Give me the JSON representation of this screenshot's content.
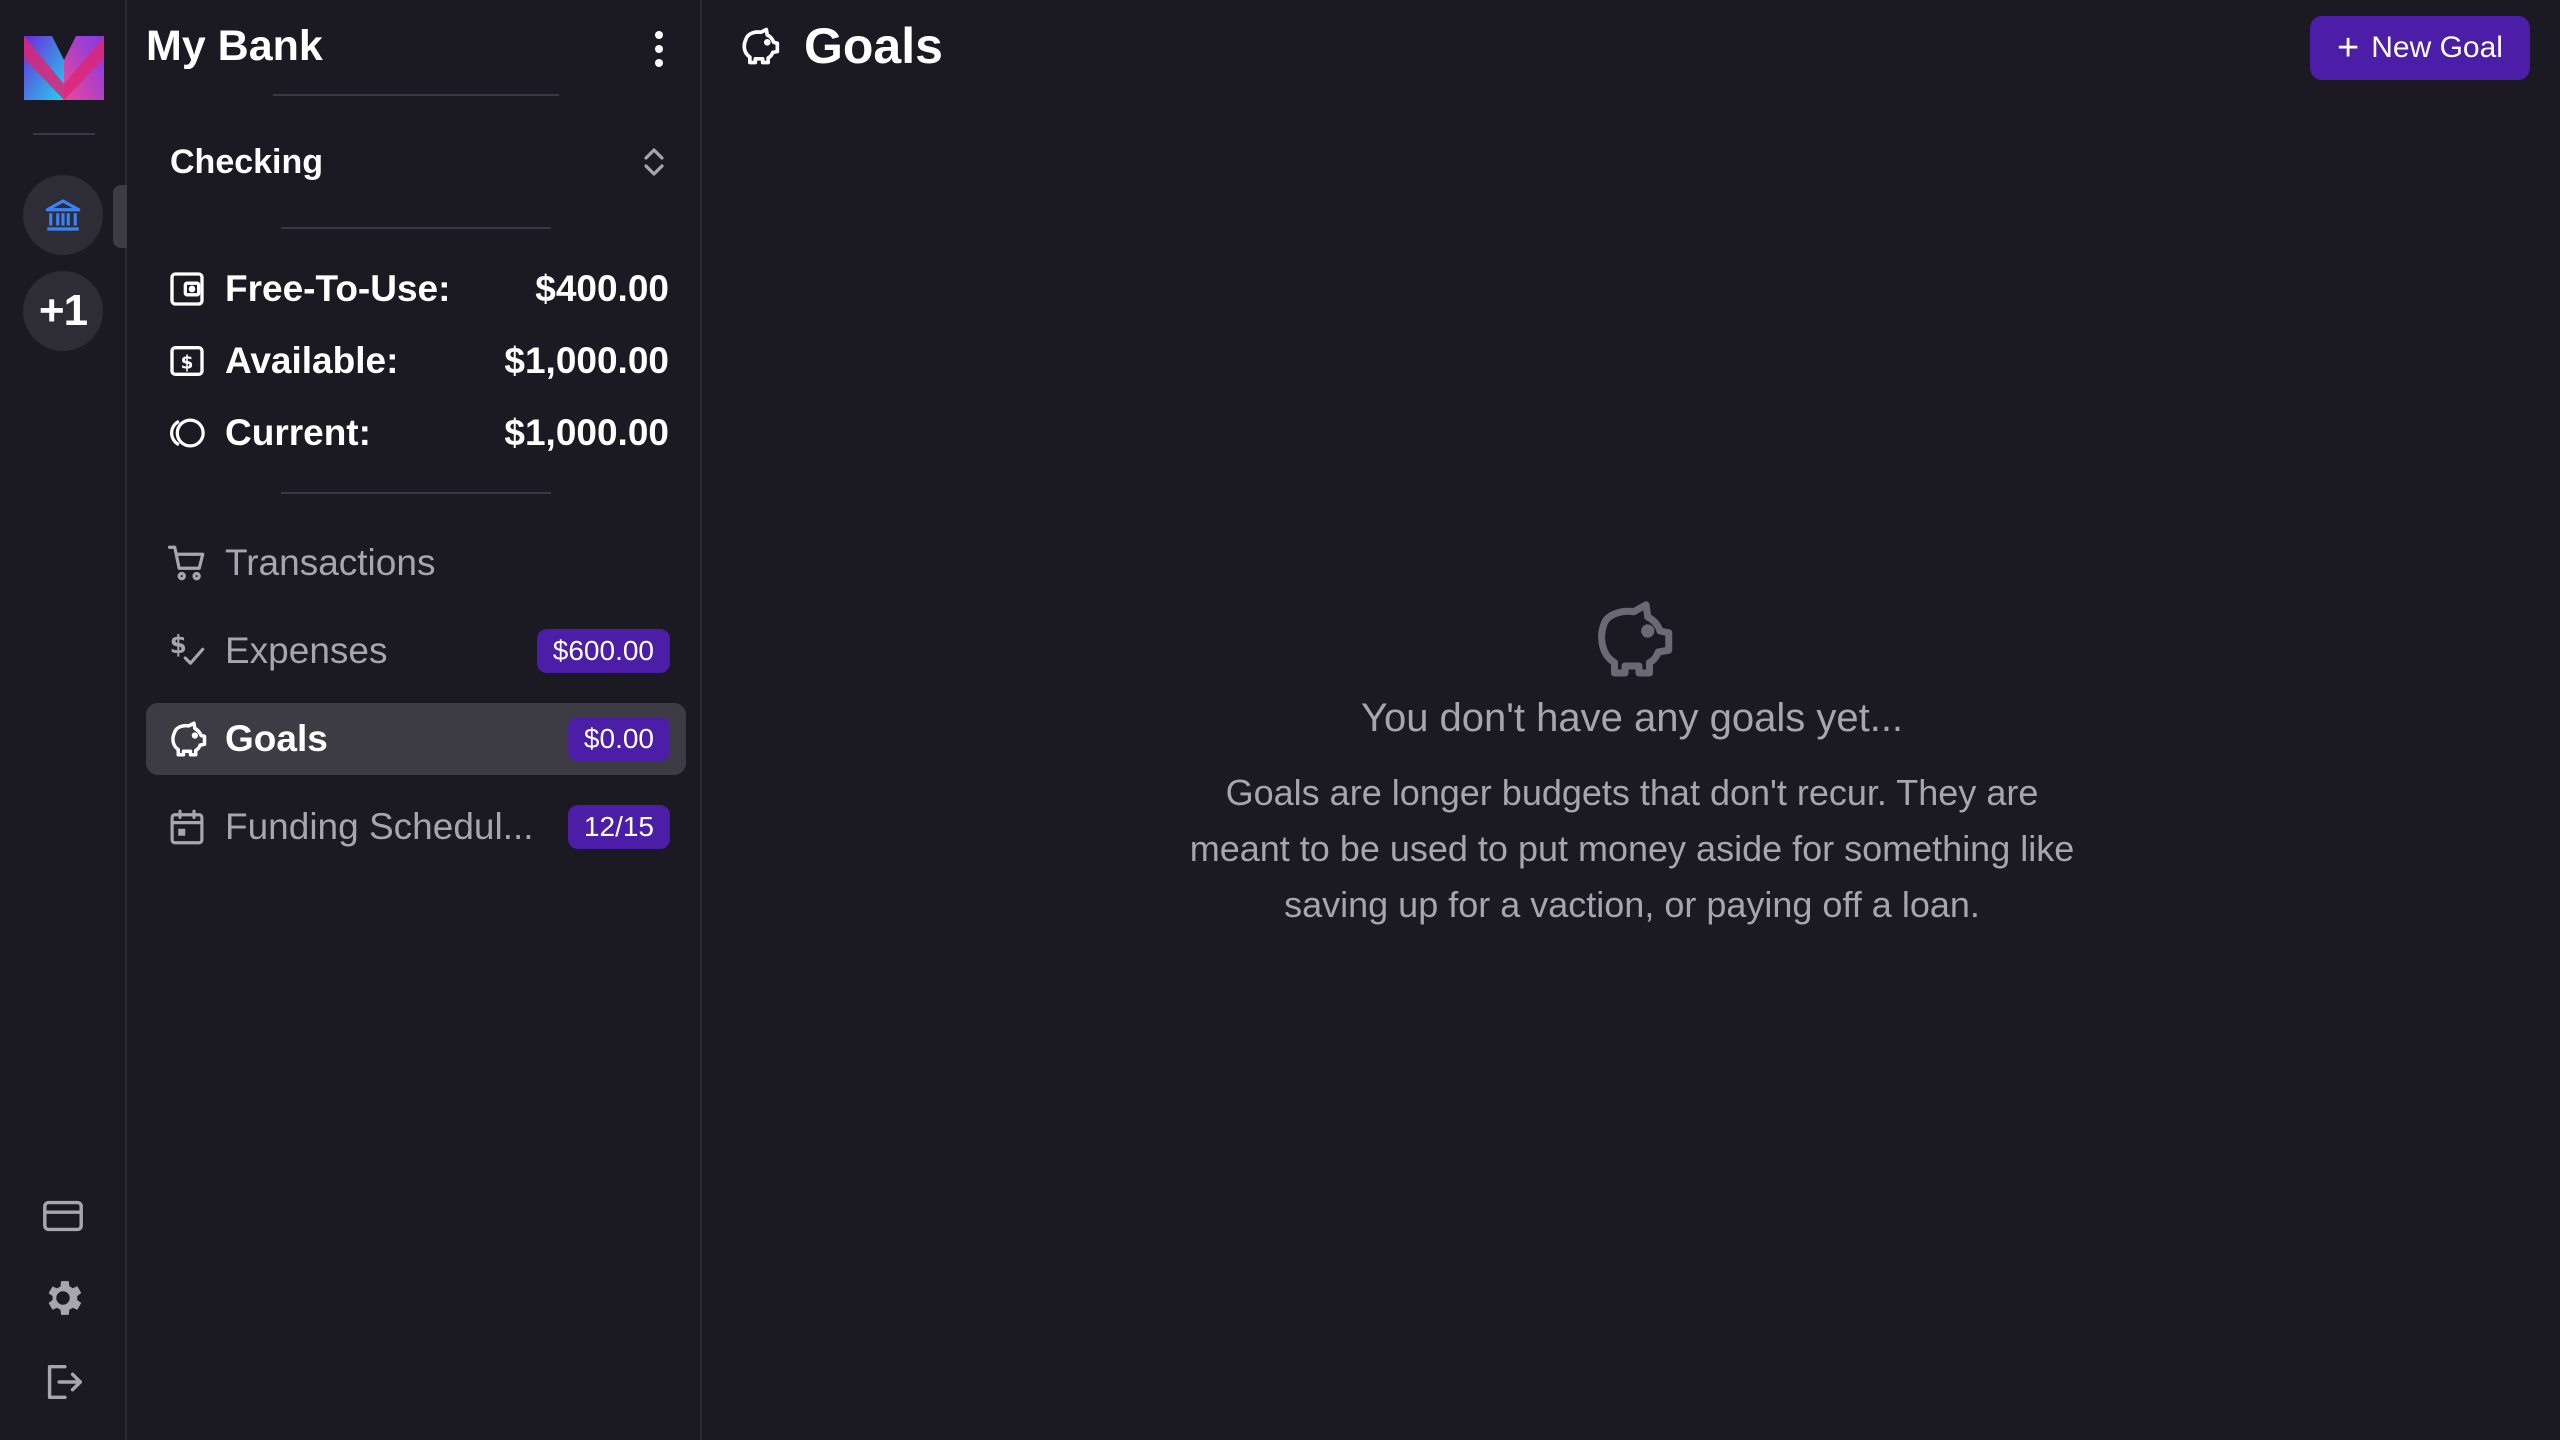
{
  "rail": {
    "add_label": "+1"
  },
  "sidebar": {
    "bank_name": "My Bank",
    "account": "Checking",
    "balances": [
      {
        "label": "Free-To-Use:",
        "value": "$400.00"
      },
      {
        "label": "Available:",
        "value": "$1,000.00"
      },
      {
        "label": "Current:",
        "value": "$1,000.00"
      }
    ],
    "nav": [
      {
        "label": "Transactions",
        "badge": ""
      },
      {
        "label": "Expenses",
        "badge": "$600.00"
      },
      {
        "label": "Goals",
        "badge": "$0.00"
      },
      {
        "label": "Funding Schedul...",
        "badge": "12/15"
      }
    ]
  },
  "main": {
    "title": "Goals",
    "new_button": "New Goal",
    "empty_title": "You don't have any goals yet...",
    "empty_description": "Goals are longer budgets that don't recur. They are meant to be used to put money aside for something like saving up for a vaction, or paying off a loan."
  },
  "colors": {
    "background": "#1b1922",
    "accent": "#4c1ea8",
    "active_item": "#3d3b44",
    "muted_text": "#a7a5ad",
    "bank_icon": "#3b82f6"
  },
  "icons": {
    "logo": "monetr-logo",
    "bank": "bank-icon",
    "wallet": "wallet-icon",
    "dollar": "dollar-bill-icon",
    "current": "coins-icon",
    "cart": "shopping-cart-icon",
    "expenses": "dollar-check-icon",
    "goals": "piggy-bank-icon",
    "schedule": "calendar-icon",
    "card": "credit-card-icon",
    "settings": "gear-icon",
    "logout": "logout-icon"
  }
}
